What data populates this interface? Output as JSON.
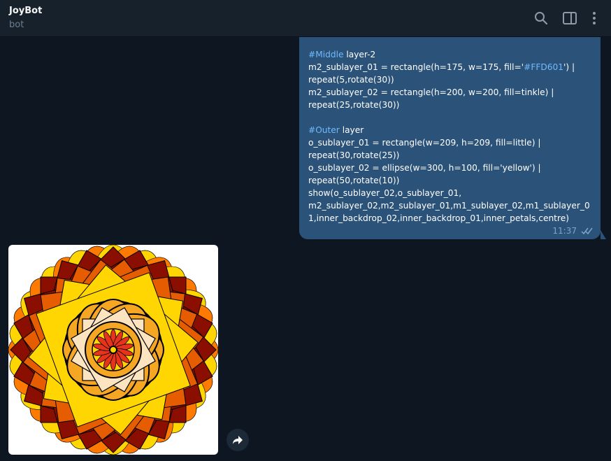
{
  "header": {
    "title": "JoyBot",
    "subtitle": "bot",
    "icons": [
      "search-icon",
      "sidebar-panel-icon",
      "more-vertical-icon"
    ]
  },
  "message": {
    "lines": [
      [
        "#Middle",
        " layer-2"
      ],
      [
        "",
        "m2_sublayer_01 = rectangle(h=175, w=175, fill='",
        "#FFD601",
        "') |"
      ],
      [
        "",
        "repeat(5,rotate(30))"
      ],
      [
        "",
        "m2_sublayer_02 = rectangle(h=200, w=200, fill=tinkle) |"
      ],
      [
        "",
        "repeat(25,rotate(30))"
      ],
      [
        "",
        ""
      ],
      [
        "#Outer",
        " layer"
      ],
      [
        "",
        "o_sublayer_01 = rectangle(w=209, h=209, fill=little) |"
      ],
      [
        "",
        "repeat(30,rotate(25))"
      ],
      [
        "",
        "o_sublayer_02 = ellipse(w=300, h=100, fill='yellow') |"
      ],
      [
        "",
        "repeat(50,rotate(10))"
      ],
      [
        "",
        "show(o_sublayer_02,o_sublayer_01,"
      ],
      [
        "",
        "m2_sublayer_02,m2_sublayer_01,m1_sublayer_02,m1_sublayer_01,inner_backdrop_02,inner_backdrop_01,inner_petals,centre)"
      ]
    ],
    "time": "11:37",
    "status_icon": "double-check-icon"
  },
  "image_message": {
    "alt_icon": "mandala-image",
    "forward_icon": "forward-arrow-icon"
  },
  "colors": {
    "background": "#0e1621",
    "header": "#17212b",
    "bubble": "#2b5278",
    "link": "#71baff"
  }
}
